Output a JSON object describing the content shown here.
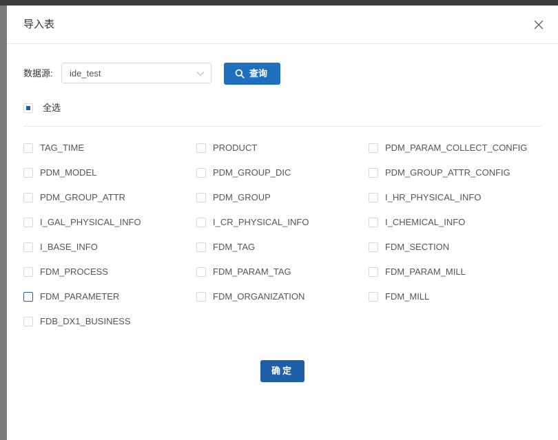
{
  "dialog": {
    "title": "导入表",
    "close_icon": "close-icon"
  },
  "datasource": {
    "label": "数据源:",
    "selected": "ide_test",
    "chevron_icon": "chevron-down-icon"
  },
  "query_button": {
    "label": "查询",
    "icon": "search-icon"
  },
  "select_all": {
    "label": "全选",
    "state": "indeterminate"
  },
  "tables": [
    {
      "label": "TAG_TIME",
      "checked": false
    },
    {
      "label": "PRODUCT",
      "checked": false
    },
    {
      "label": "PDM_PARAM_COLLECT_CONFIG",
      "checked": false
    },
    {
      "label": "PDM_MODEL",
      "checked": false
    },
    {
      "label": "PDM_GROUP_DIC",
      "checked": false
    },
    {
      "label": "PDM_GROUP_ATTR_CONFIG",
      "checked": false
    },
    {
      "label": "PDM_GROUP_ATTR",
      "checked": false
    },
    {
      "label": "PDM_GROUP",
      "checked": false
    },
    {
      "label": "I_HR_PHYSICAL_INFO",
      "checked": false
    },
    {
      "label": "I_GAL_PHYSICAL_INFO",
      "checked": false
    },
    {
      "label": "I_CR_PHYSICAL_INFO",
      "checked": false
    },
    {
      "label": "I_CHEMICAL_INFO",
      "checked": false
    },
    {
      "label": "I_BASE_INFO",
      "checked": false
    },
    {
      "label": "FDM_TAG",
      "checked": false
    },
    {
      "label": "FDM_SECTION",
      "checked": false
    },
    {
      "label": "FDM_PROCESS",
      "checked": false
    },
    {
      "label": "FDM_PARAM_TAG",
      "checked": false
    },
    {
      "label": "FDM_PARAM_MILL",
      "checked": false
    },
    {
      "label": "FDM_PARAMETER",
      "checked": false
    },
    {
      "label": "FDM_ORGANIZATION",
      "checked": false
    },
    {
      "label": "FDM_MILL",
      "checked": false
    },
    {
      "label": "FDB_DX1_BUSINESS",
      "checked": false
    }
  ],
  "confirm_button": {
    "label": "确定"
  },
  "colors": {
    "primary": "#1f6fbf",
    "confirm": "#1f5fa8",
    "checkbox_border": "#d9d9d9"
  }
}
